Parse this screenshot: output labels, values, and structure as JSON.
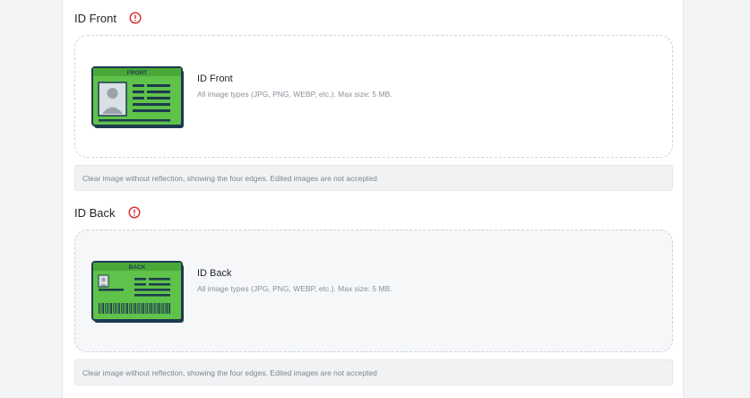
{
  "front": {
    "label": "ID Front",
    "card_word": "FRONT",
    "dropzone_title": "ID Front",
    "dropzone_hint": "All image types (JPG, PNG, WEBP, etc.). Max size: 5 MB.",
    "note": "Clear image without reflection, showing the four edges. Edited images are not accepted"
  },
  "back": {
    "label": "ID Back",
    "card_word": "BACK",
    "dropzone_title": "ID Back",
    "dropzone_hint": "All image types (JPG, PNG, WEBP, etc.). Max size: 5 MB.",
    "note": "Clear image without reflection, showing the four edges. Edited images are not accepted"
  },
  "colors": {
    "card_green": "#5fc24a",
    "card_dark": "#1d3b4f",
    "alert_red": "#d62828"
  },
  "icons": {
    "required": "alert-circle-icon",
    "front_card": "id-card-front-icon",
    "back_card": "id-card-back-icon"
  }
}
